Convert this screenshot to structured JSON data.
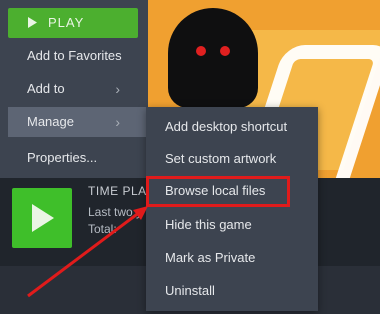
{
  "main_menu": {
    "play_label": "PLAY",
    "items": [
      {
        "label": "Add to Favorites"
      },
      {
        "label": "Add to"
      },
      {
        "label": "Manage"
      },
      {
        "label": "Properties..."
      }
    ]
  },
  "submenu": {
    "items": [
      {
        "label": "Add desktop shortcut"
      },
      {
        "label": "Set custom artwork"
      },
      {
        "label": "Browse local files"
      },
      {
        "label": "Hide this game"
      },
      {
        "label": "Mark as Private"
      },
      {
        "label": "Uninstall"
      }
    ]
  },
  "game_panel": {
    "time_title": "TIME PLA",
    "last_played": "Last two y",
    "total": "Total:"
  },
  "colors": {
    "menu_bg": "#3d4450",
    "play_green": "#4caf2f",
    "highlight_red": "#e01b1b",
    "art_orange": "#f0a030"
  },
  "icons": [
    "play-icon",
    "chevron-right-icon",
    "arrow-annotation"
  ]
}
